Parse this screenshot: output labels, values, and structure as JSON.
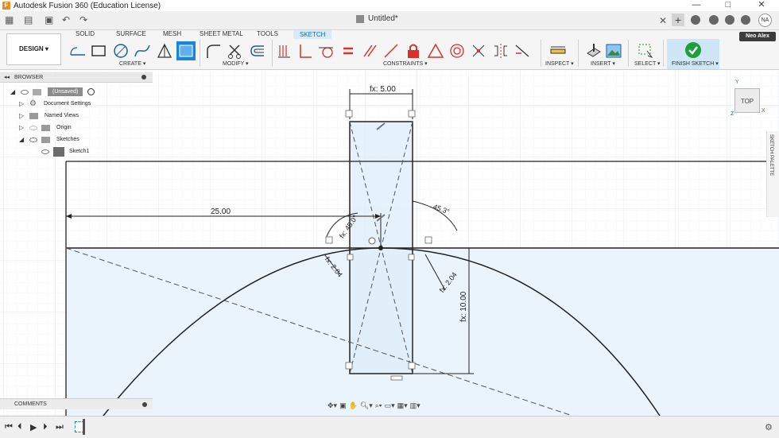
{
  "window": {
    "title": "Autodesk Fusion 360 (Education License)",
    "minimize": "—",
    "maximize": "□",
    "close": "✕"
  },
  "document": {
    "tab_title": "Untitled*",
    "close_glyph": "✕",
    "new_tab": "+"
  },
  "user": {
    "initials": "NA",
    "name": "Neo Alex"
  },
  "workspace": {
    "label": "DESIGN ▾"
  },
  "ribbon": {
    "tabs": [
      "SOLID",
      "SURFACE",
      "MESH",
      "SHEET METAL",
      "TOOLS",
      "SKETCH"
    ],
    "active_tab": "SKETCH",
    "groups": {
      "create": "CREATE ▾",
      "modify": "MODIFY ▾",
      "constraints": "CONSTRAINTS ▾",
      "inspect": "INSPECT ▾",
      "insert": "INSERT ▾",
      "select": "SELECT ▾",
      "finish": "FINISH SKETCH ▾"
    }
  },
  "browser": {
    "title": "BROWSER",
    "items": [
      {
        "label": "(Unsaved)"
      },
      {
        "label": "Document Settings"
      },
      {
        "label": "Named Views"
      },
      {
        "label": "Origin"
      },
      {
        "label": "Sketches"
      },
      {
        "label": "Sketch1"
      }
    ]
  },
  "comments": {
    "title": "COMMENTS"
  },
  "viewcube": {
    "face": "TOP",
    "axis_y": "Y",
    "axis_x": "X",
    "axis_z": "Z"
  },
  "sketch_palette": {
    "label": "SKETCH PALETTE"
  },
  "dimensions": {
    "width": "fx: 5.00",
    "horizontal": "25.00",
    "angle_left": "fx: 45.0°",
    "angle_right": "45.3°",
    "offset_left": "fx: 2.04",
    "offset_right": "fx: 2.04",
    "height": "fx: 10.00"
  },
  "colors": {
    "accent": "#0b6fc1",
    "finish_green": "#1f9f3a",
    "sketch_fill": "#eaf4fc",
    "constraint_red": "#d9302c"
  }
}
